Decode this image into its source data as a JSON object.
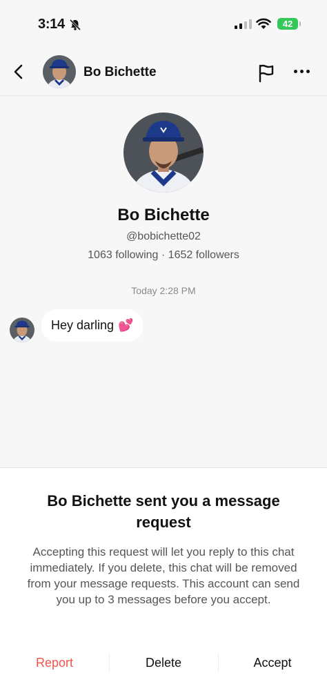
{
  "status_bar": {
    "time": "3:14",
    "battery": "42",
    "icons": [
      "bell-muted-icon",
      "cellular-signal-icon",
      "wifi-icon",
      "battery-icon"
    ]
  },
  "header": {
    "name": "Bo Bichette",
    "icons": [
      "back-chevron-icon",
      "flag-icon",
      "more-icon"
    ]
  },
  "profile": {
    "name": "Bo Bichette",
    "handle": "@bobichette02",
    "stats": "1063 following · 1652 followers"
  },
  "chat": {
    "timestamp": "Today 2:28 PM",
    "messages": [
      {
        "text": "Hey darling",
        "emoji": "💕"
      }
    ]
  },
  "request_sheet": {
    "title": "Bo Bichette sent you a message request",
    "body": "Accepting this request will let you reply to this chat immediately. If you delete, this chat will be removed from your message requests. This account can send you up to 3 messages before you accept.",
    "report_label": "Report",
    "delete_label": "Delete",
    "accept_label": "Accept"
  },
  "colors": {
    "report": "#f0544f",
    "battery": "#34c759",
    "background": "#f7f7f7"
  }
}
